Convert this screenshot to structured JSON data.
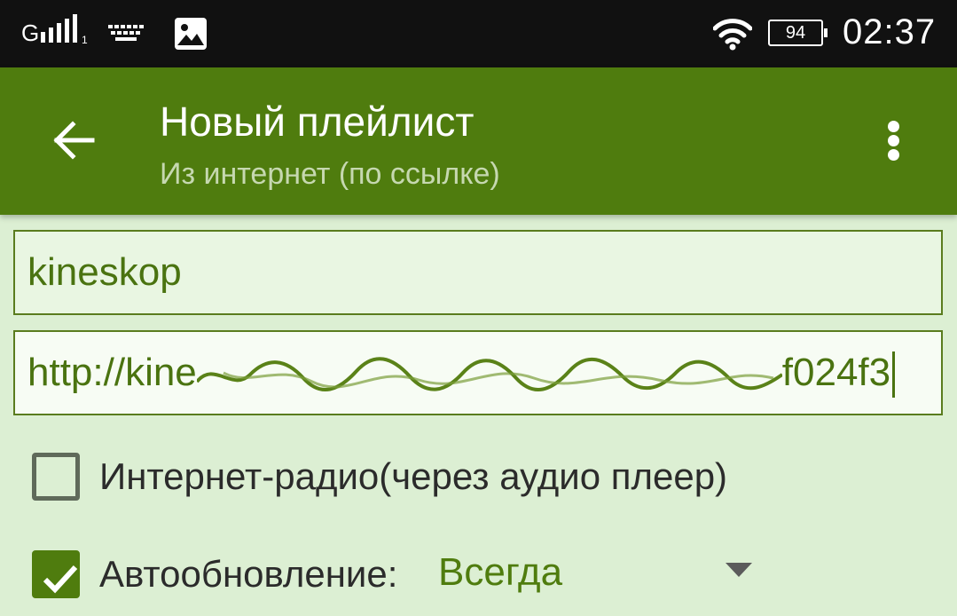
{
  "status_bar": {
    "network": "G",
    "sim": "1",
    "battery": "94",
    "time": "02:37",
    "icons": [
      "signal-icon",
      "keyboard-icon",
      "image-icon",
      "wifi-icon",
      "battery-icon"
    ]
  },
  "app_bar": {
    "title": "Новый плейлист",
    "subtitle": "Из интернет (по ссылке)",
    "back_icon": "arrow-left-icon",
    "menu_icon": "more-vert-icon"
  },
  "form": {
    "name_value": "kineskop",
    "url_value_visible_prefix": "http://kine",
    "url_value_visible_suffix": "f024f3",
    "radio_label": "Интернет-радио(через аудио плеер)",
    "radio_checked": false,
    "autoupdate_label": "Автообновление:",
    "autoupdate_checked": true,
    "autoupdate_value": "Всегда"
  },
  "colors": {
    "accent": "#4f7c0e",
    "background": "#dcefd3",
    "status_bar": "#111111"
  }
}
